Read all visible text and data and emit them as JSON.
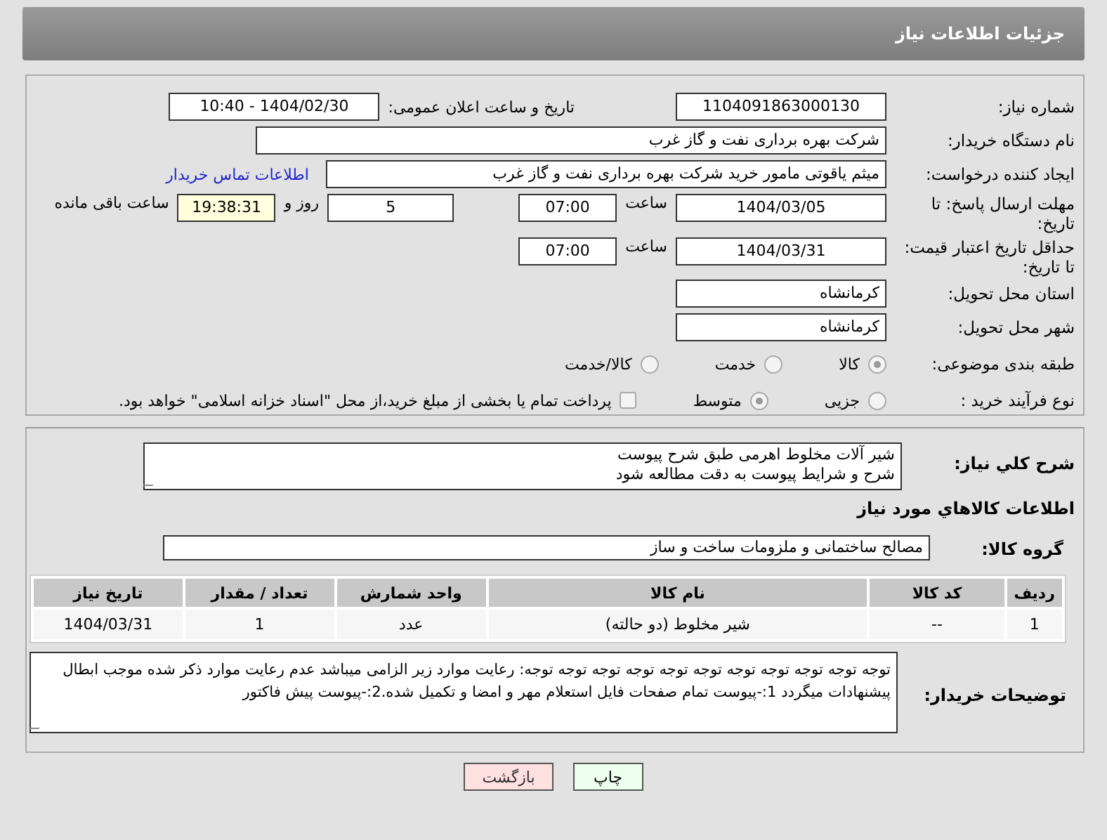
{
  "header": {
    "title": "جزئیات اطلاعات نیاز"
  },
  "need_number": {
    "label": "شماره نیاز:",
    "value": "1104091863000130"
  },
  "announce": {
    "label": "تاریخ و ساعت اعلان عمومی:",
    "value": "1404/02/30 - 10:40"
  },
  "buyer_org": {
    "label": "نام دستگاه خریدار:",
    "value": "شرکت بهره برداری نفت و گاز غرب"
  },
  "requester": {
    "label": "ایجاد کننده درخواست:",
    "value": "میثم یاقوتی مامور خرید شرکت بهره برداری نفت و گاز غرب",
    "link": "اطلاعات تماس خریدار"
  },
  "deadline": {
    "label": "مهلت ارسال پاسخ: تا تاریخ:",
    "date": "1404/03/05",
    "time_label": "ساعت",
    "time": "07:00",
    "days": "5",
    "days_label": "روز و",
    "remaining": "19:38:31",
    "remaining_label": "ساعت باقی مانده"
  },
  "validity": {
    "label": "حداقل تاریخ اعتبار قیمت: تا تاریخ:",
    "date": "1404/03/31",
    "time_label": "ساعت",
    "time": "07:00"
  },
  "province": {
    "label": "استان محل تحویل:",
    "value": "کرمانشاه"
  },
  "city": {
    "label": "شهر محل تحویل:",
    "value": "کرمانشاه"
  },
  "category": {
    "label": "طبقه بندی موضوعی:",
    "options": [
      {
        "label": "کالا",
        "selected": true
      },
      {
        "label": "خدمت",
        "selected": false
      },
      {
        "label": "کالا/خدمت",
        "selected": false
      }
    ]
  },
  "process": {
    "label": "نوع فرآیند خرید :",
    "options": [
      {
        "label": "جزیی",
        "selected": false
      },
      {
        "label": "متوسط",
        "selected": true
      }
    ],
    "payment": {
      "checked": false,
      "label": "پرداخت تمام یا بخشی از مبلغ خرید،از محل \"اسناد خزانه اسلامی\" خواهد بود."
    }
  },
  "description": {
    "label": "شرح کلي نياز:",
    "lines": [
      "شیر آلات مخلوط اهرمی طبق شرح پیوست",
      "شرح و شرایط پیوست به دقت مطالعه شود"
    ]
  },
  "goods_title": "اطلاعات کالاهاي مورد نياز",
  "goods_group": {
    "label": "گروه کالا:",
    "value": "مصالح ساختمانی و ملزومات ساخت و ساز"
  },
  "table": {
    "columns": [
      "ردیف",
      "کد کالا",
      "نام کالا",
      "واحد شمارش",
      "تعداد / مقدار",
      "تاریخ نیاز"
    ],
    "rows": [
      [
        "1",
        "--",
        "شیر مخلوط (دو حالته)",
        "عدد",
        "1",
        "1404/03/31"
      ]
    ]
  },
  "buyer_notes": {
    "label": "توضیحات خریدار:",
    "value": "توجه توجه توجه توجه توجه توجه توجه توجه توجه توجه توجه: رعایت موارد زیر الزامی میباشد عدم رعایت موارد ذکر شده موجب ابطال پیشنهادات میگردد 1:-پیوست تمام صفحات  فایل استعلام مهر و امضا و تکمیل شده.2:-پیوست پیش فاکتور"
  },
  "buttons": [
    {
      "label": "چاپ",
      "kind": "print"
    },
    {
      "label": "بازگشت",
      "kind": "back"
    }
  ]
}
